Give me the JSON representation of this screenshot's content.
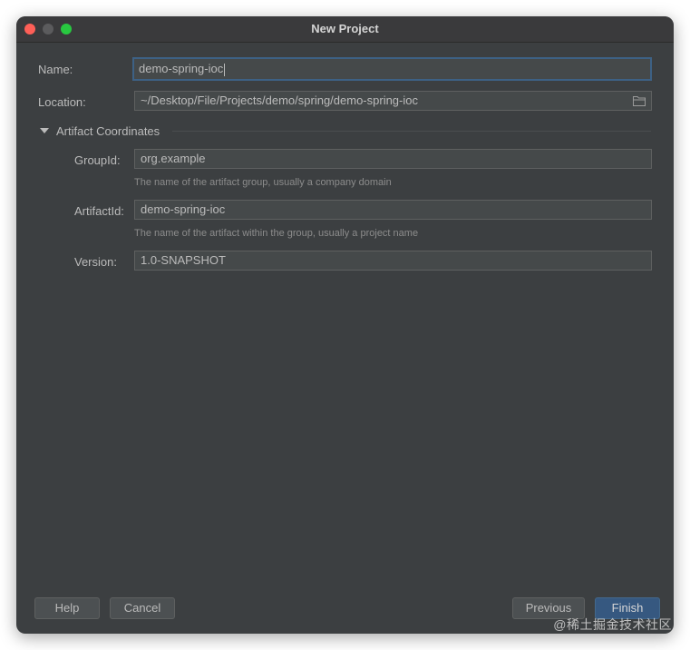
{
  "window": {
    "title": "New Project"
  },
  "form": {
    "name_label": "Name:",
    "name_value": "demo-spring-ioc",
    "location_label": "Location:",
    "location_value": "~/Desktop/File/Projects/demo/spring/demo-spring-ioc",
    "section_title": "Artifact Coordinates",
    "groupid_label": "GroupId:",
    "groupid_value": "org.example",
    "groupid_hint": "The name of the artifact group, usually a company domain",
    "artifactid_label": "ArtifactId:",
    "artifactid_value": "demo-spring-ioc",
    "artifactid_hint": "The name of the artifact within the group, usually a project name",
    "version_label": "Version:",
    "version_value": "1.0-SNAPSHOT"
  },
  "buttons": {
    "help": "Help",
    "cancel": "Cancel",
    "previous": "Previous",
    "finish": "Finish"
  },
  "watermark": "@稀土掘金技术社区",
  "colors": {
    "background": "#3c3f41",
    "field_bg": "#45494a",
    "focus_border": "#3d6185",
    "primary_button": "#365880",
    "close": "#fe5f57",
    "zoom": "#28c840"
  }
}
